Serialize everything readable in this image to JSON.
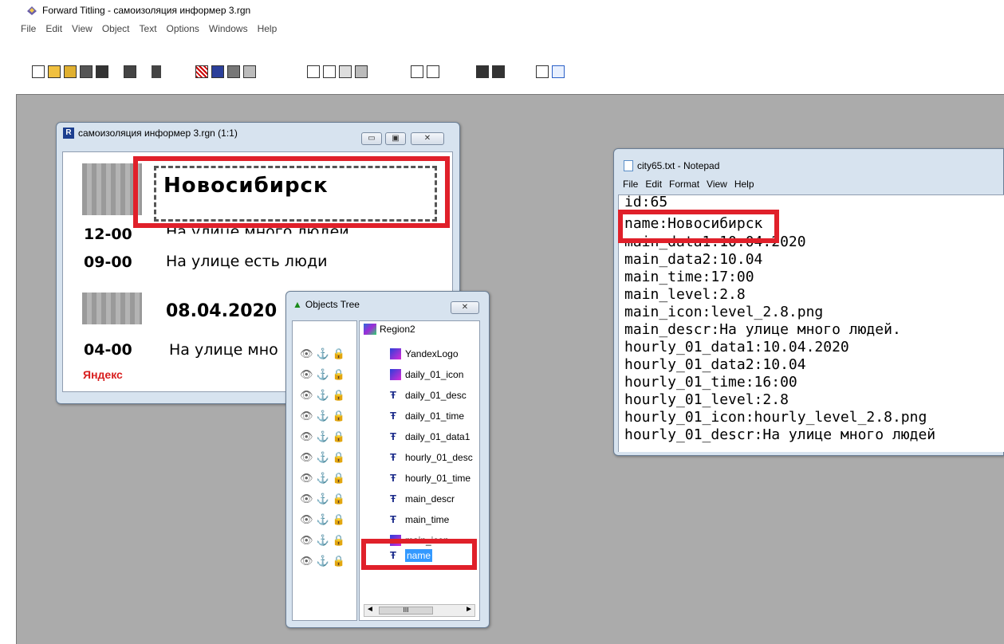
{
  "app": {
    "title": "Forward Titling - самоизоляция информер 3.rgn",
    "menu": [
      "File",
      "Edit",
      "View",
      "Object",
      "Text",
      "Options",
      "Windows",
      "Help"
    ]
  },
  "region_window": {
    "title": "самоизоляция информер 3.rgn  (1:1)",
    "name_text": "Новосибирск",
    "row1_time": "12-00",
    "row1_text": "На улице много людей",
    "row2_time": "09-00",
    "row2_text": "На улице есть люди",
    "date": "08.04.2020",
    "row3_time": "04-00",
    "row3_text": "На улице мно",
    "logo": "Яндекс"
  },
  "objects_tree": {
    "title": "Objects Tree",
    "root": "Region2",
    "items": [
      {
        "label": "YandexLogo",
        "icon": "image-icon"
      },
      {
        "label": "daily_01_icon",
        "icon": "image-icon"
      },
      {
        "label": "daily_01_desc",
        "icon": "text-icon"
      },
      {
        "label": "daily_01_time",
        "icon": "text-icon"
      },
      {
        "label": "daily_01_data1",
        "icon": "text-icon"
      },
      {
        "label": "hourly_01_desc",
        "icon": "text-icon"
      },
      {
        "label": "hourly_01_time",
        "icon": "text-icon"
      },
      {
        "label": "main_descr",
        "icon": "text-icon"
      },
      {
        "label": "main_time",
        "icon": "text-icon"
      },
      {
        "label": "main_icon",
        "icon": "image-icon"
      },
      {
        "label": "name",
        "icon": "text-icon"
      }
    ],
    "scroll_label": "III"
  },
  "notepad": {
    "title": "city65.txt - Notepad",
    "menu": [
      "File",
      "Edit",
      "Format",
      "View",
      "Help"
    ],
    "lines": [
      "id:65",
      "name:Новосибирск",
      "main_data1:10.04.2020",
      "main_data2:10.04",
      "main_time:17:00",
      "main_level:2.8",
      "main_icon:level_2.8.png",
      "main_descr:На улице много людей.",
      "hourly_01_data1:10.04.2020",
      "hourly_01_data2:10.04",
      "hourly_01_time:16:00",
      "hourly_01_level:2.8",
      "hourly_01_icon:hourly_level_2.8.png",
      "hourly_01_descr:На улице много людей"
    ]
  },
  "colors": {
    "highlight": "#e0202a",
    "selection": "#3399ff",
    "workspace": "#ababab"
  }
}
